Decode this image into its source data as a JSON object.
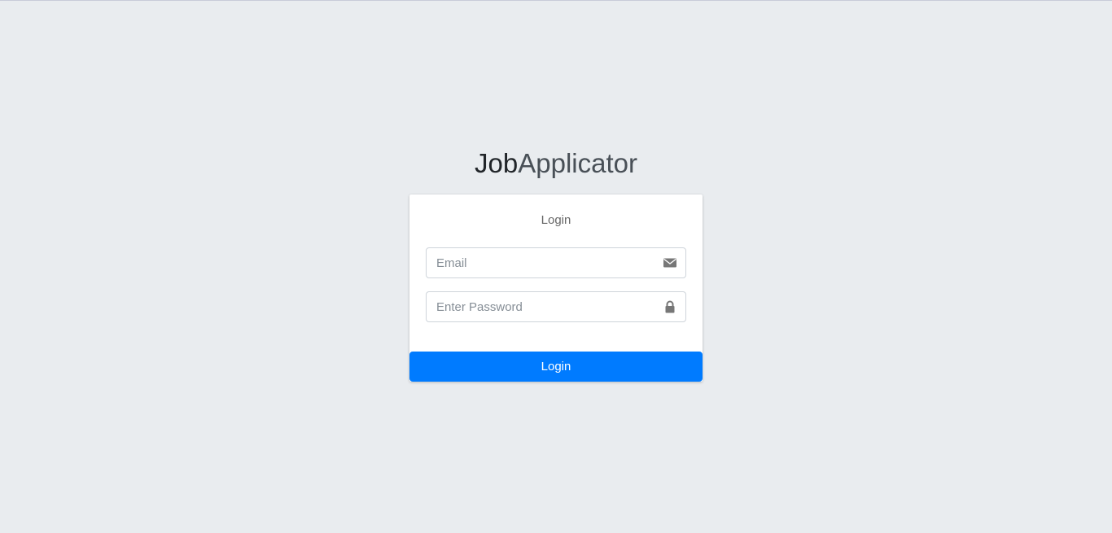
{
  "logo": {
    "strong": "Job",
    "light": "Applicator"
  },
  "login_box": {
    "message": "Login",
    "email": {
      "placeholder": "Email",
      "value": "",
      "icon": "envelope-icon"
    },
    "password": {
      "placeholder": "Enter Password",
      "value": "",
      "icon": "lock-icon"
    },
    "submit_label": "Login"
  },
  "colors": {
    "background": "#e9ecef",
    "primary": "#007bff",
    "icon": "#777777"
  }
}
